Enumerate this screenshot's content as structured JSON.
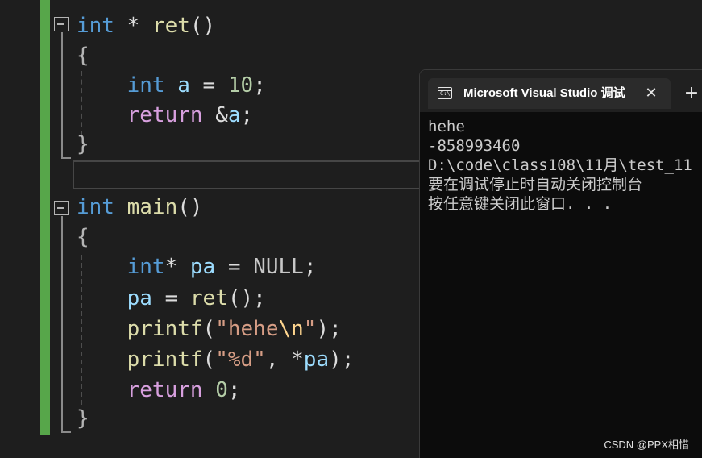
{
  "editor": {
    "lines": [
      {
        "tokens": [
          [
            "kw",
            "int"
          ],
          [
            "plain",
            " * "
          ],
          [
            "fn",
            "ret"
          ],
          [
            "plain",
            "()"
          ]
        ]
      },
      {
        "tokens": [
          [
            "brace",
            "{"
          ]
        ]
      },
      {
        "tokens": [
          [
            "plain",
            "    "
          ],
          [
            "kw",
            "int"
          ],
          [
            "plain",
            " "
          ],
          [
            "var",
            "a"
          ],
          [
            "plain",
            " = "
          ],
          [
            "num",
            "10"
          ],
          [
            "plain",
            ";"
          ]
        ]
      },
      {
        "tokens": [
          [
            "plain",
            "    "
          ],
          [
            "ctrl",
            "return"
          ],
          [
            "plain",
            " &"
          ],
          [
            "var",
            "a"
          ],
          [
            "plain",
            ";"
          ]
        ]
      },
      {
        "tokens": [
          [
            "brace",
            "}"
          ]
        ]
      },
      {
        "tokens": []
      },
      {
        "tokens": [
          [
            "kw",
            "int"
          ],
          [
            "plain",
            " "
          ],
          [
            "fn",
            "main"
          ],
          [
            "plain",
            "()"
          ]
        ]
      },
      {
        "tokens": [
          [
            "brace",
            "{"
          ]
        ]
      },
      {
        "tokens": [
          [
            "plain",
            "    "
          ],
          [
            "kw",
            "int"
          ],
          [
            "plain",
            "* "
          ],
          [
            "var",
            "pa"
          ],
          [
            "plain",
            " = "
          ],
          [
            "mac",
            "NULL"
          ],
          [
            "plain",
            ";"
          ]
        ]
      },
      {
        "tokens": [
          [
            "plain",
            "    "
          ],
          [
            "var",
            "pa"
          ],
          [
            "plain",
            " = "
          ],
          [
            "fn",
            "ret"
          ],
          [
            "plain",
            "();"
          ]
        ]
      },
      {
        "tokens": [
          [
            "plain",
            "    "
          ],
          [
            "fn",
            "printf"
          ],
          [
            "plain",
            "("
          ],
          [
            "str",
            "\"hehe"
          ],
          [
            "esc",
            "\\n"
          ],
          [
            "str",
            "\""
          ],
          [
            "plain",
            ");"
          ]
        ]
      },
      {
        "tokens": [
          [
            "plain",
            "    "
          ],
          [
            "fn",
            "printf"
          ],
          [
            "plain",
            "("
          ],
          [
            "str",
            "\"%d\""
          ],
          [
            "plain",
            ", *"
          ],
          [
            "var",
            "pa"
          ],
          [
            "plain",
            ");"
          ]
        ]
      },
      {
        "tokens": [
          [
            "plain",
            "    "
          ],
          [
            "ctrl",
            "return"
          ],
          [
            "plain",
            " "
          ],
          [
            "num",
            "0"
          ],
          [
            "plain",
            ";"
          ]
        ]
      },
      {
        "tokens": [
          [
            "brace",
            "}"
          ]
        ]
      }
    ]
  },
  "console": {
    "tab_title": "Microsoft Visual Studio 调试控制台",
    "tab_icon_text": "C:\\",
    "close_glyph": "✕",
    "new_tab_glyph": "+",
    "output": [
      "hehe",
      "-858993460",
      "D:\\code\\class108\\11月\\test_11",
      "要在调试停止时自动关闭控制台",
      "按任意键关闭此窗口. . ."
    ]
  },
  "watermark": "CSDN @PPX相惜",
  "colors": {
    "background": "#1e1e1e",
    "keyword": "#569cd6",
    "control": "#d8a0df",
    "function": "#dcdcaa",
    "variable": "#9cdcfe",
    "number": "#b5cea8",
    "string": "#d69d85",
    "change_bar": "#57a64a",
    "console_bg": "#0c0c0c"
  }
}
